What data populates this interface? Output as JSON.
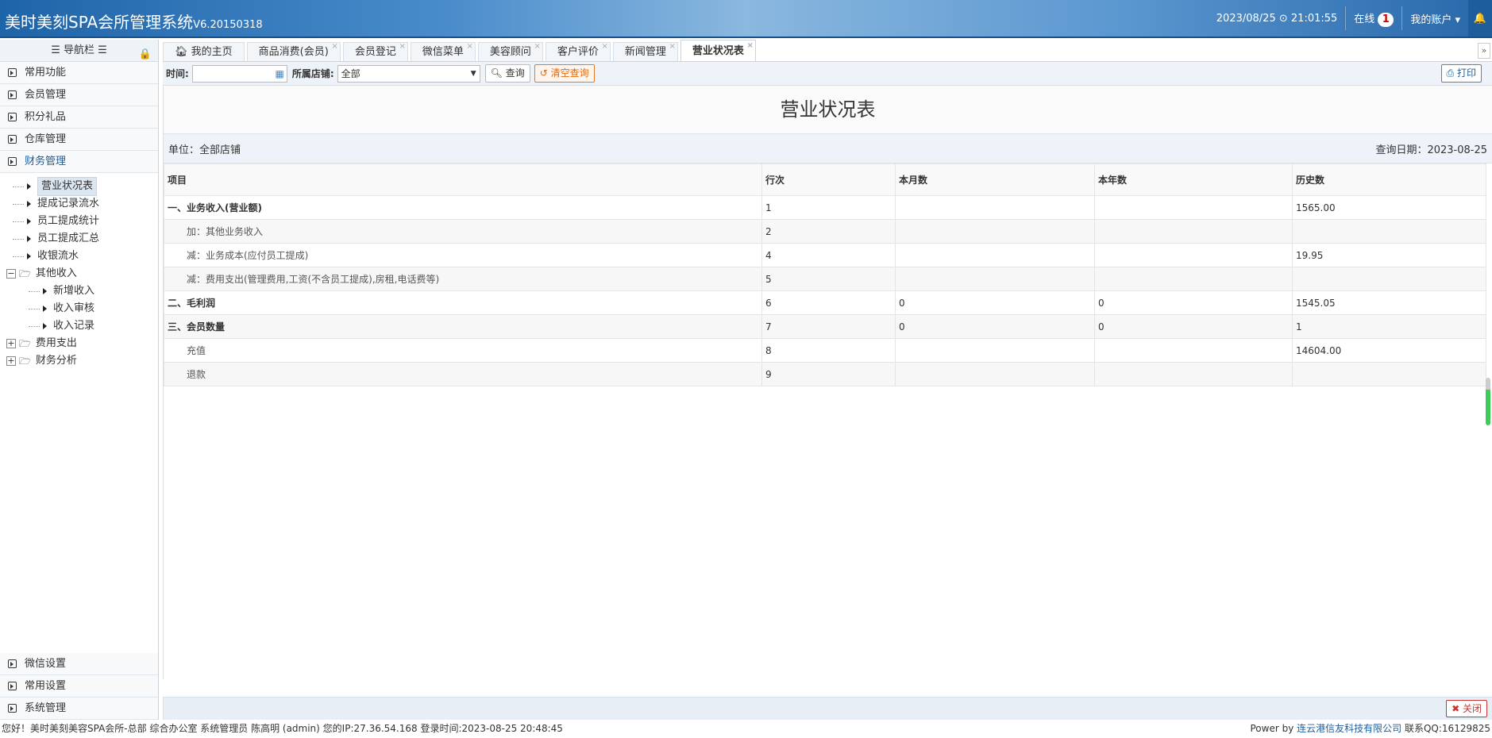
{
  "header": {
    "title": "美时美刻SPA会所管理系统",
    "version": "V6.20150318",
    "date": "2023/08/25",
    "time": "21:01:55",
    "online_label": "在线",
    "online_count": "1",
    "account": "我的账户"
  },
  "sidebar": {
    "title": "导航栏",
    "menus_top": [
      "常用功能",
      "会员管理",
      "积分礼品",
      "仓库管理",
      "财务管理"
    ],
    "tree": [
      {
        "label": "营业状况表",
        "level": 1,
        "selected": true
      },
      {
        "label": "提成记录流水",
        "level": 1
      },
      {
        "label": "员工提成统计",
        "level": 1
      },
      {
        "label": "员工提成汇总",
        "level": 1
      },
      {
        "label": "收银流水",
        "level": 1
      },
      {
        "label": "其他收入",
        "folder": true,
        "expanded": true
      },
      {
        "label": "新增收入",
        "level": 2
      },
      {
        "label": "收入审核",
        "level": 2
      },
      {
        "label": "收入记录",
        "level": 2
      },
      {
        "label": "费用支出",
        "folder": true
      },
      {
        "label": "财务分析",
        "folder": true
      }
    ],
    "menus_bottom": [
      "微信设置",
      "常用设置",
      "系统管理"
    ]
  },
  "tabs": [
    {
      "label": "我的主页"
    },
    {
      "label": "商品消费(会员)"
    },
    {
      "label": "会员登记"
    },
    {
      "label": "微信菜单"
    },
    {
      "label": "美容顾问"
    },
    {
      "label": "客户评价"
    },
    {
      "label": "新闻管理"
    },
    {
      "label": "营业状况表",
      "active": true
    }
  ],
  "toolbar": {
    "time_label": "时间:",
    "time_value": "",
    "store_label": "所属店铺:",
    "store_value": "全部",
    "search": "查询",
    "clear": "清空查询",
    "print": "打印"
  },
  "report": {
    "title": "营业状况表",
    "unit": "单位：全部店铺",
    "query_date": "查询日期：2023-08-25",
    "columns": [
      "项目",
      "行次",
      "本月数",
      "本年数",
      "历史数"
    ],
    "rows": [
      [
        "一、业务收入(营业额)",
        "1",
        "",
        "",
        "1565.00"
      ],
      [
        "加：其他业务收入",
        "2",
        "",
        "",
        ""
      ],
      [
        "减：业务成本(应付员工提成)",
        "4",
        "",
        "",
        "19.95"
      ],
      [
        "减：费用支出(管理费用,工资(不含员工提成),房租,电话费等)",
        "5",
        "",
        "",
        ""
      ],
      [
        "二、毛利润",
        "6",
        "0",
        "0",
        "1545.05"
      ],
      [
        "三、会员数量",
        "7",
        "0",
        "0",
        "1"
      ],
      [
        "充值",
        "8",
        "",
        "",
        "14604.00"
      ],
      [
        "退款",
        "9",
        "",
        "",
        ""
      ]
    ]
  },
  "close": "关闭",
  "status": {
    "left": "您好！美时美刻美容SPA会所-总部 综合办公室 系统管理员 陈高明 (admin) 您的IP:27.36.54.168 登录时间:2023-08-25 20:48:45",
    "power": "Power by",
    "company": "连云港信友科技有限公司",
    "qq": "联系QQ:16129825"
  }
}
